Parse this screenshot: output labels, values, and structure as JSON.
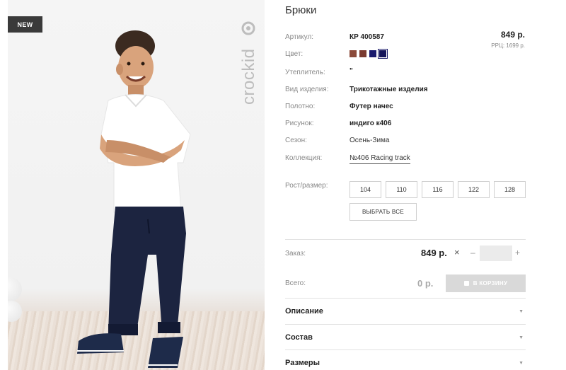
{
  "badge": "NEW",
  "product": {
    "title": "Брюки",
    "price": "849 р.",
    "rrp": "РРЦ: 1699 р."
  },
  "specs": {
    "article_label": "Артикул:",
    "article_value": "КР 400587",
    "color_label": "Цвет:",
    "insulation_label": "Утеплитель:",
    "insulation_value": "\"",
    "type_label": "Вид изделия:",
    "type_value": "Трикотажные изделия",
    "fabric_label": "Полотно:",
    "fabric_value": "Футер начес",
    "print_label": "Рисунок:",
    "print_value": "индиго к406",
    "season_label": "Сезон:",
    "season_value": "Осень-Зима",
    "collection_label": "Коллекция:",
    "collection_value": "№406 Racing track"
  },
  "colors": [
    {
      "hex": "#8b4a3a",
      "selected": false
    },
    {
      "hex": "#7a3a30",
      "selected": false
    },
    {
      "hex": "#1a1a6e",
      "selected": false
    },
    {
      "hex": "#14145a",
      "selected": true
    }
  ],
  "sizes": {
    "label": "Рост/размер:",
    "options": [
      "104",
      "110",
      "116",
      "122",
      "128"
    ],
    "select_all": "ВЫБРАТЬ ВСЕ"
  },
  "order": {
    "label": "Заказ:",
    "price": "849 р.",
    "remove": "×",
    "minus": "–",
    "plus": "+",
    "quantity": ""
  },
  "total": {
    "label": "Всего:",
    "value": "0 р.",
    "cart_button": "В КОРЗИНУ"
  },
  "accordions": [
    {
      "label": "Описание"
    },
    {
      "label": "Состав"
    },
    {
      "label": "Размеры"
    }
  ]
}
